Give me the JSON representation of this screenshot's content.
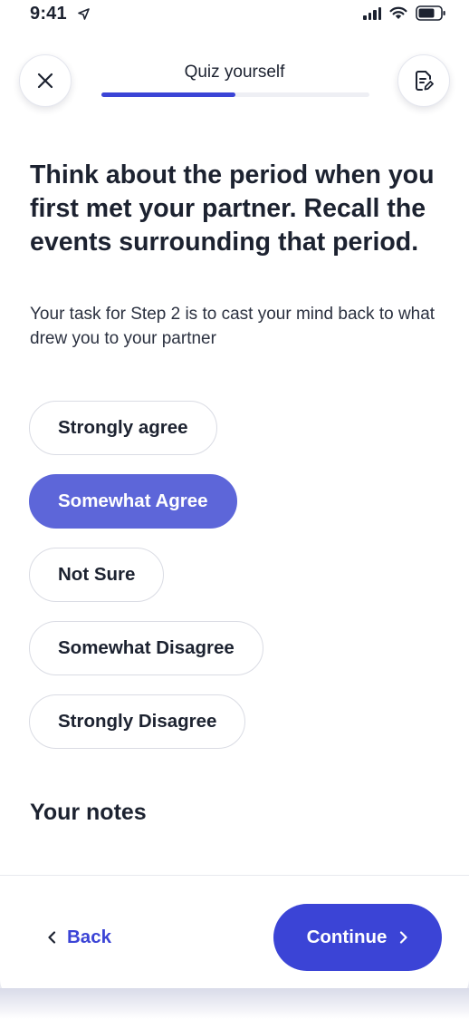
{
  "status_bar": {
    "time": "9:41"
  },
  "header": {
    "title": "Quiz yourself",
    "progress": 0.5,
    "close_icon": "close-icon",
    "notes_icon": "notes-edit-icon"
  },
  "question": {
    "title": "Think about the period when you first met your partner. Recall the events surrounding that period.",
    "subtitle": "Your task for Step 2 is to cast your mind back to what drew you to your partner"
  },
  "options": [
    {
      "label": "Strongly agree",
      "selected": false
    },
    {
      "label": "Somewhat Agree",
      "selected": true
    },
    {
      "label": "Not Sure",
      "selected": false
    },
    {
      "label": "Somewhat Disagree",
      "selected": false
    },
    {
      "label": "Strongly Disagree",
      "selected": false
    }
  ],
  "notes": {
    "heading": "Your notes"
  },
  "footer": {
    "back_label": "Back",
    "continue_label": "Continue"
  },
  "colors": {
    "accent": "#3b44d6",
    "selected_option": "#5d66d9",
    "text": "#1c2230",
    "border": "#dadce4"
  }
}
